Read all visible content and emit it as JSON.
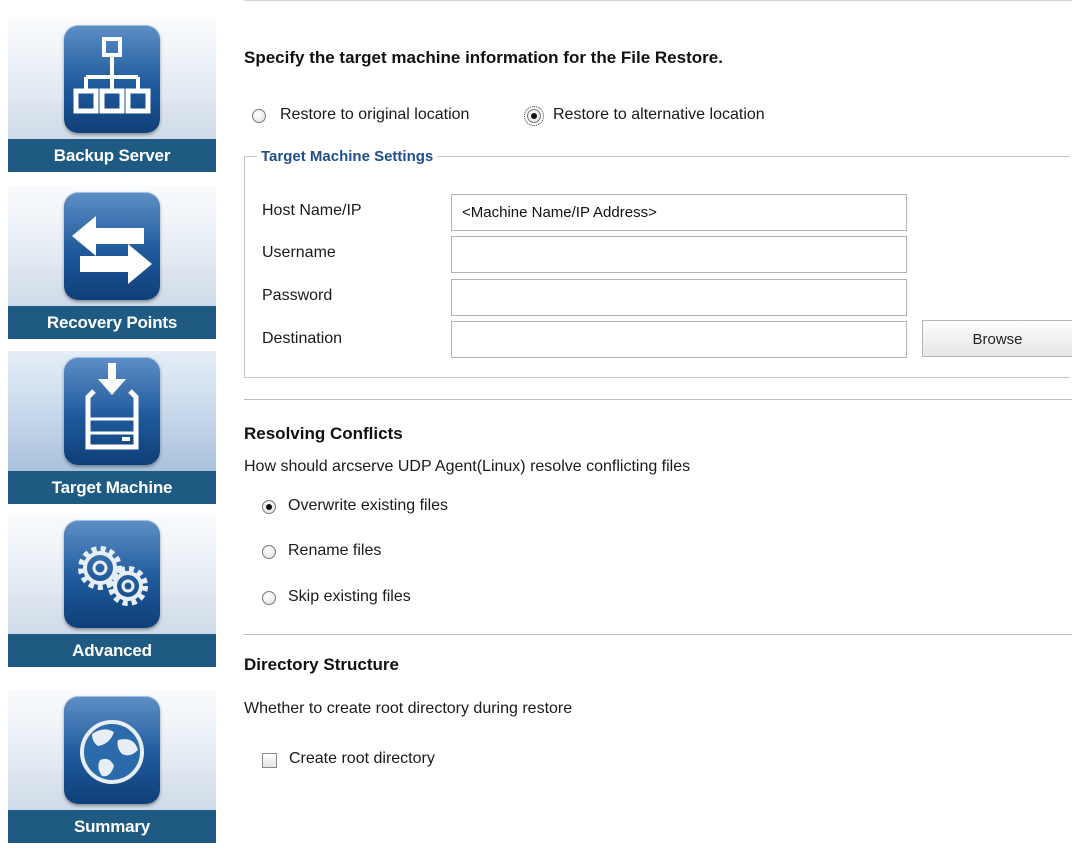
{
  "sidebar": {
    "steps": [
      {
        "label": "Backup Server",
        "icon": "network-hierarchy-icon"
      },
      {
        "label": "Recovery Points",
        "icon": "swap-arrows-icon"
      },
      {
        "label": "Target Machine",
        "icon": "drive-download-icon"
      },
      {
        "label": "Advanced",
        "icon": "gears-icon"
      },
      {
        "label": "Summary",
        "icon": "globe-icon"
      }
    ],
    "active_step": "Target Machine",
    "label_bar_color": "#1f5a83"
  },
  "main": {
    "heading": "Specify the target machine information for the File Restore.",
    "location": {
      "options": [
        "Restore to original location",
        "Restore to alternative location"
      ],
      "selected": "Restore to alternative location"
    },
    "target_settings": {
      "legend": "Target Machine Settings",
      "host_label": "Host Name/IP",
      "host_placeholder": "<Machine Name/IP Address>",
      "username_label": "Username",
      "username_value": "",
      "password_label": "Password",
      "password_value": "",
      "destination_label": "Destination",
      "destination_value": "",
      "browse_label": "Browse"
    },
    "conflicts": {
      "title": "Resolving Conflicts",
      "description": "How should arcserve UDP Agent(Linux) resolve conflicting files",
      "options": [
        "Overwrite existing files",
        "Rename files",
        "Skip existing files"
      ],
      "selected": "Overwrite existing files"
    },
    "directory": {
      "title": "Directory Structure",
      "description": "Whether to create root directory during restore",
      "checkbox_label": "Create root directory",
      "checked": false
    }
  }
}
